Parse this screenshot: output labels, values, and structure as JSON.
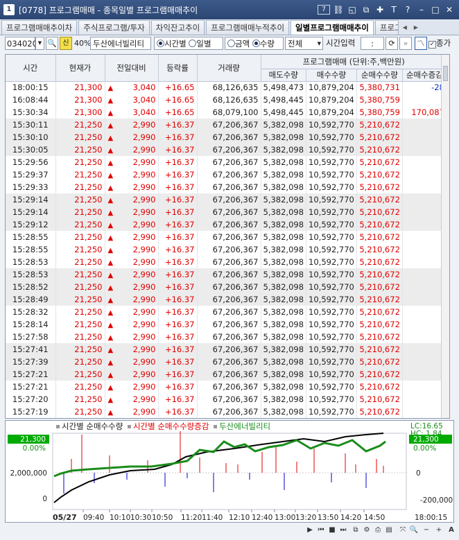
{
  "window": {
    "app_num": "1",
    "title": "[0778] 프로그램매매 - 종목일별 프로그램매매추이",
    "code_btn": "7"
  },
  "tabs": [
    {
      "label": "프로그램매매추이차"
    },
    {
      "label": "주식프로그램/투자"
    },
    {
      "label": "차익잔고추이"
    },
    {
      "label": "프로그램매매누적추이"
    },
    {
      "label": "일별프로그램매매추이",
      "active": true
    },
    {
      "label": "프로그"
    }
  ],
  "toolbar": {
    "code": "034020",
    "credit_badge": "신",
    "margin": "40%",
    "stock_name": "두산에너빌리티",
    "radio_time": "시간별",
    "radio_daily": "일별",
    "radio_amount": "금액",
    "radio_qty": "수량",
    "market_select": "전체",
    "time_input_label": "시간입력",
    "time_input_value": ":",
    "close_label": "종가"
  },
  "table": {
    "headers": {
      "time": "시간",
      "price": "현재가",
      "change": "전일대비",
      "rate": "등락률",
      "volume": "거래량",
      "group": "프로그램매매 (단위:주,백만원)",
      "sell": "매도수량",
      "buy": "매수수량",
      "net": "순매수수량",
      "net_chg": "순매수증감"
    },
    "rows": [
      {
        "time": "18:00:15",
        "price": "21,300",
        "change": "3,040",
        "rate": "+16.65",
        "volume": "68,126,635",
        "sell": "5,498,473",
        "buy": "10,879,204",
        "net": "5,380,731",
        "net_chg": "-28",
        "shaded": false
      },
      {
        "time": "16:08:44",
        "price": "21,300",
        "change": "3,040",
        "rate": "+16.65",
        "volume": "68,126,635",
        "sell": "5,498,445",
        "buy": "10,879,204",
        "net": "5,380,759",
        "net_chg": "",
        "shaded": false
      },
      {
        "time": "15:30:34",
        "price": "21,300",
        "change": "3,040",
        "rate": "+16.65",
        "volume": "68,079,100",
        "sell": "5,498,445",
        "buy": "10,879,204",
        "net": "5,380,759",
        "net_chg": "170,087",
        "shaded": false
      },
      {
        "time": "15:30:11",
        "price": "21,250",
        "change": "2,990",
        "rate": "+16.37",
        "volume": "67,206,367",
        "sell": "5,382,098",
        "buy": "10,592,770",
        "net": "5,210,672",
        "net_chg": "",
        "shaded": true
      },
      {
        "time": "15:30:10",
        "price": "21,250",
        "change": "2,990",
        "rate": "+16.37",
        "volume": "67,206,367",
        "sell": "5,382,098",
        "buy": "10,592,770",
        "net": "5,210,672",
        "net_chg": "",
        "shaded": true
      },
      {
        "time": "15:30:05",
        "price": "21,250",
        "change": "2,990",
        "rate": "+16.37",
        "volume": "67,206,367",
        "sell": "5,382,098",
        "buy": "10,592,770",
        "net": "5,210,672",
        "net_chg": "",
        "shaded": true
      },
      {
        "time": "15:29:56",
        "price": "21,250",
        "change": "2,990",
        "rate": "+16.37",
        "volume": "67,206,367",
        "sell": "5,382,098",
        "buy": "10,592,770",
        "net": "5,210,672",
        "net_chg": "",
        "shaded": false
      },
      {
        "time": "15:29:37",
        "price": "21,250",
        "change": "2,990",
        "rate": "+16.37",
        "volume": "67,206,367",
        "sell": "5,382,098",
        "buy": "10,592,770",
        "net": "5,210,672",
        "net_chg": "",
        "shaded": false
      },
      {
        "time": "15:29:33",
        "price": "21,250",
        "change": "2,990",
        "rate": "+16.37",
        "volume": "67,206,367",
        "sell": "5,382,098",
        "buy": "10,592,770",
        "net": "5,210,672",
        "net_chg": "",
        "shaded": false
      },
      {
        "time": "15:29:14",
        "price": "21,250",
        "change": "2,990",
        "rate": "+16.37",
        "volume": "67,206,367",
        "sell": "5,382,098",
        "buy": "10,592,770",
        "net": "5,210,672",
        "net_chg": "",
        "shaded": true
      },
      {
        "time": "15:29:14",
        "price": "21,250",
        "change": "2,990",
        "rate": "+16.37",
        "volume": "67,206,367",
        "sell": "5,382,098",
        "buy": "10,592,770",
        "net": "5,210,672",
        "net_chg": "",
        "shaded": true
      },
      {
        "time": "15:29:12",
        "price": "21,250",
        "change": "2,990",
        "rate": "+16.37",
        "volume": "67,206,367",
        "sell": "5,382,098",
        "buy": "10,592,770",
        "net": "5,210,672",
        "net_chg": "",
        "shaded": true
      },
      {
        "time": "15:28:55",
        "price": "21,250",
        "change": "2,990",
        "rate": "+16.37",
        "volume": "67,206,367",
        "sell": "5,382,098",
        "buy": "10,592,770",
        "net": "5,210,672",
        "net_chg": "",
        "shaded": false
      },
      {
        "time": "15:28:55",
        "price": "21,250",
        "change": "2,990",
        "rate": "+16.37",
        "volume": "67,206,367",
        "sell": "5,382,098",
        "buy": "10,592,770",
        "net": "5,210,672",
        "net_chg": "",
        "shaded": false
      },
      {
        "time": "15:28:53",
        "price": "21,250",
        "change": "2,990",
        "rate": "+16.37",
        "volume": "67,206,367",
        "sell": "5,382,098",
        "buy": "10,592,770",
        "net": "5,210,672",
        "net_chg": "",
        "shaded": false
      },
      {
        "time": "15:28:53",
        "price": "21,250",
        "change": "2,990",
        "rate": "+16.37",
        "volume": "67,206,367",
        "sell": "5,382,098",
        "buy": "10,592,770",
        "net": "5,210,672",
        "net_chg": "",
        "shaded": true
      },
      {
        "time": "15:28:52",
        "price": "21,250",
        "change": "2,990",
        "rate": "+16.37",
        "volume": "67,206,367",
        "sell": "5,382,098",
        "buy": "10,592,770",
        "net": "5,210,672",
        "net_chg": "",
        "shaded": true
      },
      {
        "time": "15:28:49",
        "price": "21,250",
        "change": "2,990",
        "rate": "+16.37",
        "volume": "67,206,367",
        "sell": "5,382,098",
        "buy": "10,592,770",
        "net": "5,210,672",
        "net_chg": "",
        "shaded": true
      },
      {
        "time": "15:28:32",
        "price": "21,250",
        "change": "2,990",
        "rate": "+16.37",
        "volume": "67,206,367",
        "sell": "5,382,098",
        "buy": "10,592,770",
        "net": "5,210,672",
        "net_chg": "",
        "shaded": false
      },
      {
        "time": "15:28:14",
        "price": "21,250",
        "change": "2,990",
        "rate": "+16.37",
        "volume": "67,206,367",
        "sell": "5,382,098",
        "buy": "10,592,770",
        "net": "5,210,672",
        "net_chg": "",
        "shaded": false
      },
      {
        "time": "15:27:58",
        "price": "21,250",
        "change": "2,990",
        "rate": "+16.37",
        "volume": "67,206,367",
        "sell": "5,382,098",
        "buy": "10,592,770",
        "net": "5,210,672",
        "net_chg": "",
        "shaded": false
      },
      {
        "time": "15:27:41",
        "price": "21,250",
        "change": "2,990",
        "rate": "+16.37",
        "volume": "67,206,367",
        "sell": "5,382,098",
        "buy": "10,592,770",
        "net": "5,210,672",
        "net_chg": "",
        "shaded": true
      },
      {
        "time": "15:27:39",
        "price": "21,250",
        "change": "2,990",
        "rate": "+16.37",
        "volume": "67,206,367",
        "sell": "5,382,098",
        "buy": "10,592,770",
        "net": "5,210,672",
        "net_chg": "",
        "shaded": true
      },
      {
        "time": "15:27:21",
        "price": "21,250",
        "change": "2,990",
        "rate": "+16.37",
        "volume": "67,206,367",
        "sell": "5,382,098",
        "buy": "10,592,770",
        "net": "5,210,672",
        "net_chg": "",
        "shaded": true
      },
      {
        "time": "15:27:21",
        "price": "21,250",
        "change": "2,990",
        "rate": "+16.37",
        "volume": "67,206,367",
        "sell": "5,382,098",
        "buy": "10,592,770",
        "net": "5,210,672",
        "net_chg": "",
        "shaded": false
      },
      {
        "time": "15:27:20",
        "price": "21,250",
        "change": "2,990",
        "rate": "+16.37",
        "volume": "67,206,367",
        "sell": "5,382,098",
        "buy": "10,592,770",
        "net": "5,210,672",
        "net_chg": "",
        "shaded": false
      },
      {
        "time": "15:27:19",
        "price": "21,250",
        "change": "2,990",
        "rate": "+16.37",
        "volume": "67,206,367",
        "sell": "5,382,098",
        "buy": "10,592,770",
        "net": "5,210,672",
        "net_chg": "",
        "shaded": false
      }
    ]
  },
  "chart": {
    "legend": [
      "시간별 순매수수량",
      "시간별 순매수수량증감",
      "두산에너빌리티"
    ],
    "colors": {
      "net_qty": "#000000",
      "net_chg_pos": "#e00000",
      "net_chg_neg": "#0000cc",
      "price": "#1a8c1a",
      "highlight_bg": "#00aa00"
    },
    "left_axis": [
      "2,000,000",
      "0"
    ],
    "left_badge_price": "21,300",
    "left_badge_pct": "0.00%",
    "right_info": {
      "lc": "LC:16.65",
      "hc": "HC: 1.84"
    },
    "right_badge_price": "21,300",
    "right_badge_pct": "0.00%",
    "right_axis": [
      "0",
      "-200,000"
    ],
    "date_label": "05/27",
    "time_ticks": [
      "09:40",
      "10:10",
      "10:30",
      "10:50",
      "11:20",
      "11:40",
      "12:10",
      "12:40",
      "13:00",
      "13:20",
      "13:50",
      "14:20",
      "14:50"
    ],
    "cursor_time": "18:00:15"
  }
}
